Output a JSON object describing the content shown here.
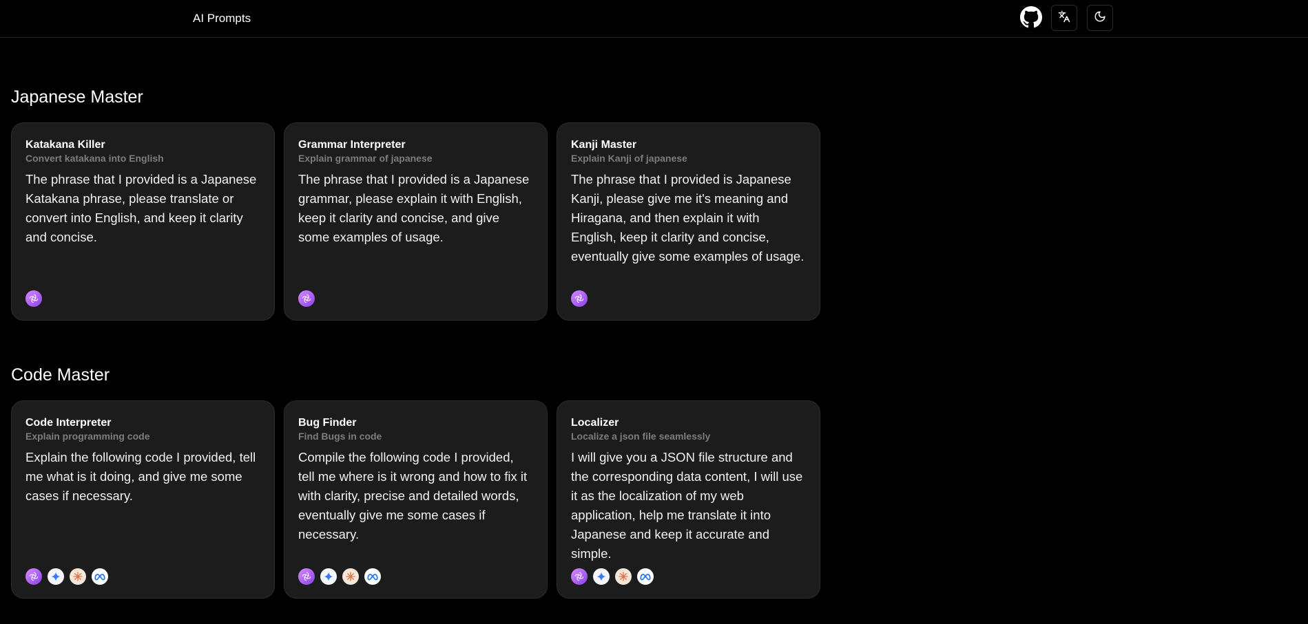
{
  "header": {
    "brand": "AI Prompts",
    "icons": [
      "github-icon",
      "translate-icon",
      "moon-icon"
    ]
  },
  "sections": [
    {
      "title": "Japanese Master",
      "cards": [
        {
          "title": "Katakana Killer",
          "subtitle": "Convert katakana into English",
          "body": "The phrase that I provided is a Japanese Katakana phrase, please translate or convert into English, and keep it clarity and concise.",
          "models": [
            "openai"
          ]
        },
        {
          "title": "Grammar Interpreter",
          "subtitle": "Explain grammar of japanese",
          "body": "The phrase that I provided is a Japanese grammar, please explain it with English, keep it clarity and concise, and give some examples of usage.",
          "models": [
            "openai"
          ]
        },
        {
          "title": "Kanji Master",
          "subtitle": "Explain Kanji of japanese",
          "body": "The phrase that I provided is Japanese Kanji, please give me it's meaning and Hiragana, and then explain it with English, keep it clarity and concise, eventually give some examples of usage.",
          "models": [
            "openai"
          ]
        }
      ]
    },
    {
      "title": "Code Master",
      "cards": [
        {
          "title": "Code Interpreter",
          "subtitle": "Explain programming code",
          "body": "Explain the following code I provided, tell me what is it doing, and give me some cases if necessary.",
          "models": [
            "openai",
            "gemini",
            "claude",
            "meta"
          ]
        },
        {
          "title": "Bug Finder",
          "subtitle": "Find Bugs in code",
          "body": "Compile the following code I provided, tell me where is it wrong and how to fix it with clarity, precise and detailed words, eventually give me some cases if necessary.",
          "models": [
            "openai",
            "gemini",
            "claude",
            "meta"
          ]
        },
        {
          "title": "Localizer",
          "subtitle": "Localize a json file seamlessly",
          "body": "I will give you a JSON file structure and the corresponding data content, I will use it as the localization of my web application, help me translate it into Japanese and keep it accurate and simple.",
          "models": [
            "openai",
            "gemini",
            "claude",
            "meta"
          ]
        }
      ]
    }
  ]
}
